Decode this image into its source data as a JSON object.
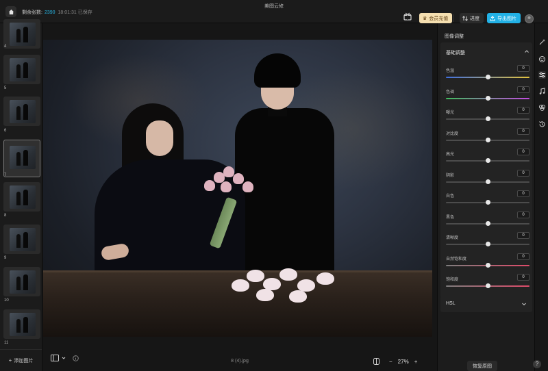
{
  "app": {
    "title": "美图云修",
    "remaining_label": "剩余张数:",
    "remaining_count": "2390",
    "saved_status": "18:01:31 已保存"
  },
  "topbar": {
    "vip_label": "会员充值",
    "progress_label": "进度",
    "export_label": "导出图片",
    "accent_color": "#22b1e6"
  },
  "filmstrip": {
    "items": [
      {
        "number": "4"
      },
      {
        "number": "5"
      },
      {
        "number": "6"
      },
      {
        "number": "7",
        "selected": true
      },
      {
        "number": "8"
      },
      {
        "number": "9"
      },
      {
        "number": "10"
      },
      {
        "number": "11"
      }
    ],
    "add_label": "添加图片"
  },
  "canvas": {
    "file_name": "8 (4).jpg",
    "zoom": "27%",
    "zoom_minus": "−",
    "zoom_plus": "+"
  },
  "panel": {
    "title": "图像调整",
    "basic_title": "基础调整",
    "sliders": [
      {
        "label": "色温",
        "value": "0",
        "position": 0.5,
        "gradient": "linear-gradient(90deg,#3f6fe0,#e5c43c)"
      },
      {
        "label": "色调",
        "value": "0",
        "position": 0.5,
        "gradient": "linear-gradient(90deg,#3fbd5d,#c24be0)"
      },
      {
        "label": "曝光",
        "value": "0",
        "position": 0.5
      },
      {
        "label": "对比度",
        "value": "0",
        "position": 0.5
      },
      {
        "label": "高光",
        "value": "0",
        "position": 0.5
      },
      {
        "label": "阴影",
        "value": "0",
        "position": 0.5
      },
      {
        "label": "白色",
        "value": "0",
        "position": 0.5
      },
      {
        "label": "黑色",
        "value": "0",
        "position": 0.5
      },
      {
        "label": "清晰度",
        "value": "0",
        "position": 0.5
      },
      {
        "label": "自然饱和度",
        "value": "0",
        "position": 0.5,
        "gradient": "linear-gradient(90deg,#7d7d7d,#e04b6a)"
      },
      {
        "label": "饱和度",
        "value": "0",
        "position": 0.5,
        "gradient": "linear-gradient(90deg,#7d7d7d,#e04b6a)"
      }
    ],
    "hsl_title": "HSL",
    "restore_label": "恢复原图"
  },
  "help": "?"
}
